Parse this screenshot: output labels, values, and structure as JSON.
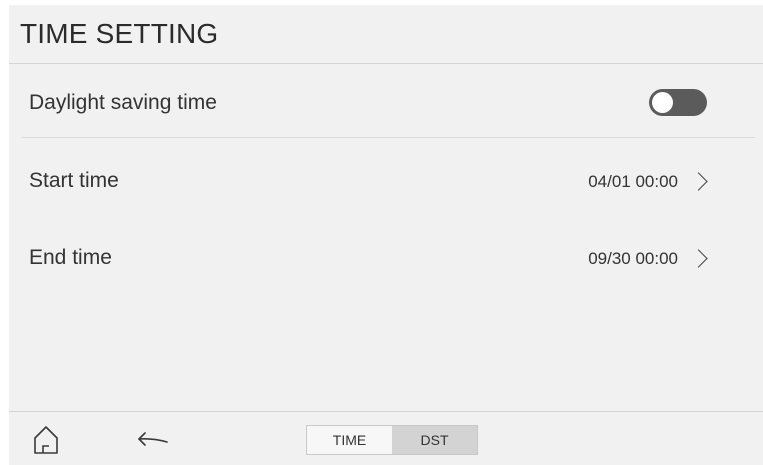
{
  "header": {
    "title": "TIME SETTING"
  },
  "dst": {
    "label": "Daylight saving time",
    "enabled": false
  },
  "start": {
    "label": "Start time",
    "value": "04/01 00:00"
  },
  "end": {
    "label": "End time",
    "value": "09/30 00:00"
  },
  "footer": {
    "home_icon": "home-icon",
    "back_icon": "back-arrow-icon",
    "tabs": [
      {
        "label": "TIME",
        "active": false
      },
      {
        "label": "DST",
        "active": true
      }
    ]
  },
  "colors": {
    "background": "#f1f1f1",
    "toggle_off": "#5b5b5b",
    "active_tab": "#d3d3d3"
  }
}
